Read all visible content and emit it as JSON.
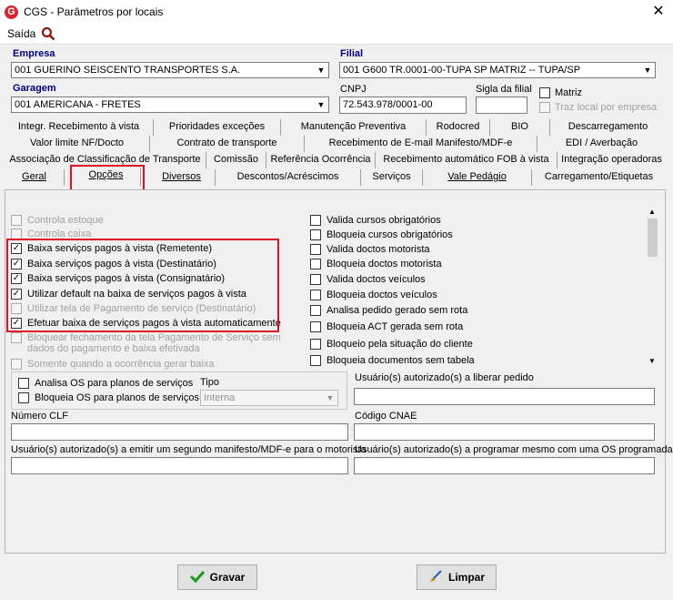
{
  "window": {
    "title": "CGS - Parâmetros por locais",
    "close": "✕"
  },
  "menu": {
    "saida": "Saída"
  },
  "fields": {
    "empresa_label": "Empresa",
    "empresa_value": "001 GUERINO SEISCENTO TRANSPORTES S.A.",
    "filial_label": "Filial",
    "filial_value": "001 G600 TR.0001-00-TUPA SP MATRIZ -- TUPA/SP",
    "garagem_label": "Garagem",
    "garagem_value": "001 AMERICANA - FRETES",
    "cnpj_label": "CNPJ",
    "cnpj_value": "72.543.978/0001-00",
    "sigla_label": "Sigla da filial",
    "sigla_value": "",
    "matriz_label": "Matriz",
    "traz_local_label": "Traz local por empresa"
  },
  "tabs": {
    "row1": [
      "Integr. Recebimento à vista",
      "Prioridades exceções",
      "Manutenção Preventiva",
      "Rodocred",
      "BIO",
      "Descarregamento"
    ],
    "row2": [
      "Valor limite NF/Docto",
      "Contrato de transporte",
      "Recebimento de E-mail Manifesto/MDF-e",
      "EDI / Averbação"
    ],
    "row3": [
      "Associação de Classificação de Transporte",
      "Comissão",
      "Referência Ocorrência",
      "Recebimento automático FOB à vista",
      "Integração operadoras"
    ],
    "row4": [
      "Geral",
      "Opções",
      "Diversos",
      "Descontos/Acréscimos",
      "Serviços",
      "Vale Pedágio",
      "Carregamento/Etiquetas"
    ]
  },
  "left_options": [
    {
      "label": "Controla estoque",
      "checked": false,
      "disabled": true
    },
    {
      "label": "Controla caixa",
      "checked": false,
      "disabled": true
    },
    {
      "label": "Baixa serviços pagos à vista (Remetente)",
      "checked": true,
      "disabled": false
    },
    {
      "label": "Baixa serviços pagos à vista (Destinatário)",
      "checked": true,
      "disabled": false
    },
    {
      "label": "Baixa serviços pagos à vista (Consignatário)",
      "checked": true,
      "disabled": false
    },
    {
      "label": "Utilizar default na baixa de serviços pagos à vista",
      "checked": true,
      "disabled": false
    },
    {
      "label": "Utilizar tela de Pagamento de serviço (Destinatário)",
      "checked": false,
      "disabled": true
    },
    {
      "label": "Efetuar baixa de serviços pagos à vista automaticamente",
      "checked": true,
      "disabled": false
    },
    {
      "label": "Bloquear fechamento da tela Pagamento de Serviço sem",
      "label2": "dados do pagamento e baixa efetivada",
      "checked": false,
      "disabled": true
    },
    {
      "label": "Somente quando a ocorrência gerar baixa",
      "checked": false,
      "disabled": true
    }
  ],
  "right_options": [
    "Valida cursos obrigatórios",
    "Bloqueia cursos obrigatórios",
    "Valida doctos motorista",
    "Bloqueia doctos motorista",
    "Valida doctos veículos",
    "Bloqueia doctos veículos",
    "Analisa pedido gerado sem rota",
    "Bloqueia ACT gerada sem rota",
    "Bloqueio pela situação do cliente",
    "Bloqueia documentos sem tabela"
  ],
  "os_group": {
    "analisa": "Analisa OS para planos de serviços",
    "bloqueia": "Bloqueia OS para planos de serviços",
    "tipo_label": "Tipo",
    "tipo_value": "Interna"
  },
  "lower_fields": {
    "usuario_liberar": "Usuário(s) autorizado(s) a liberar pedido",
    "numero_clf": "Número CLF",
    "codigo_cnae": "Código CNAE",
    "usuario_manifesto": "Usuário(s) autorizado(s) a emitir um segundo manifesto/MDF-e para o motorista",
    "usuario_programar": "Usuário(s) autorizado(s) a programar mesmo com uma OS programada"
  },
  "buttons": {
    "gravar": "Gravar",
    "limpar": "Limpar"
  },
  "colors": {
    "highlight": "#e01020",
    "label_blue": "#000080"
  }
}
